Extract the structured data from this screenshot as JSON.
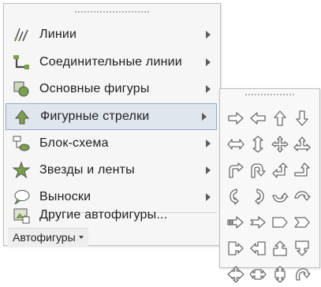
{
  "menu": {
    "items": [
      {
        "label": "Линии",
        "icon": "lines-icon",
        "has_submenu": true
      },
      {
        "label": "Соединительные линии",
        "icon": "connectors-icon",
        "has_submenu": true
      },
      {
        "label": "Основные фигуры",
        "icon": "basic-shapes-icon",
        "has_submenu": true
      },
      {
        "label": "Фигурные стрелки",
        "icon": "block-arrows-icon",
        "has_submenu": true,
        "selected": true
      },
      {
        "label": "Блок-схема",
        "icon": "flowchart-icon",
        "has_submenu": true
      },
      {
        "label": "Звезды и ленты",
        "icon": "stars-banners-icon",
        "has_submenu": true
      },
      {
        "label": "Выноски",
        "icon": "callouts-icon",
        "has_submenu": true
      },
      {
        "label": "Другие автофигуры...",
        "icon": "more-autoshapes-icon",
        "has_submenu": false
      }
    ],
    "footer_button": "Автофигуры"
  },
  "submenu": {
    "title": "Фигурные стрелки",
    "shapes": [
      "arrow-right-icon",
      "arrow-left-icon",
      "arrow-up-icon",
      "arrow-down-icon",
      "arrow-left-right-icon",
      "arrow-up-down-icon",
      "arrow-quad-icon",
      "arrow-left-right-up-icon",
      "arrow-bent-icon",
      "arrow-u-turn-icon",
      "arrow-left-up-icon",
      "arrow-bent-up-icon",
      "arrow-curved-right-icon",
      "arrow-curved-left-icon",
      "arrow-curved-up-icon",
      "arrow-curved-down-icon",
      "arrow-striped-right-icon",
      "arrow-notched-right-icon",
      "pentagon-icon",
      "chevron-icon",
      "callout-right-arrow-icon",
      "callout-left-arrow-icon",
      "callout-up-arrow-icon",
      "callout-down-arrow-icon",
      "callout-quad-arrow-icon",
      "callout-left-right-arrow-icon",
      "callout-up-down-arrow-icon",
      "arrow-circular-icon"
    ]
  },
  "colors": {
    "menu_bg": "#f6f6f6",
    "selection_bg": "#dfe6ee",
    "selection_border": "#9aa9ba"
  }
}
